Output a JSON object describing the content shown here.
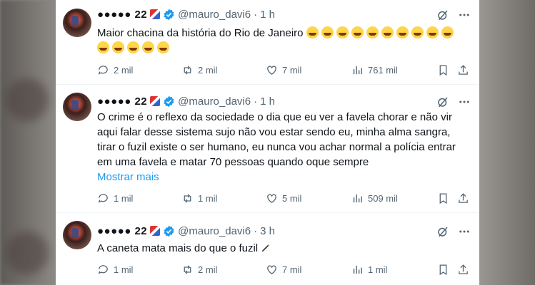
{
  "tweets": [
    {
      "name": "●●●●● 22",
      "handle": "@mauro_davi6",
      "dot": "·",
      "time": "1 h",
      "text": "Maior chacina da história do Rio de Janeiro",
      "emoji_count": 15,
      "more": "",
      "replies": "2 mil",
      "retweets": "2 mil",
      "likes": "7 mil",
      "views": "761 mil"
    },
    {
      "name": "●●●●● 22",
      "handle": "@mauro_davi6",
      "dot": "·",
      "time": "1 h",
      "text": "O crime é o reflexo da sociedade o dia que eu ver a favela chorar e não vir aqui falar desse sistema sujo não vou estar sendo eu, minha alma sangra, tirar o fuzil existe o ser humano, eu nunca vou achar normal a polícia entrar em uma favela e matar 70 pessoas quando oque sempre",
      "more": "Mostrar mais",
      "replies": "1 mil",
      "retweets": "1 mil",
      "likes": "5 mil",
      "views": "509 mil"
    },
    {
      "name": "●●●●● 22",
      "handle": "@mauro_davi6",
      "dot": "·",
      "time": "3 h",
      "text": "A caneta mata mais do que o fuzil",
      "more": "",
      "replies": "1 mil",
      "retweets": "2 mil",
      "likes": "7 mil",
      "views": "1 mil"
    }
  ],
  "icons": [
    "reply-icon",
    "retweet-icon",
    "like-icon",
    "views-icon",
    "bookmark-icon",
    "share-icon",
    "grok-icon",
    "more-icon",
    "verified-icon"
  ],
  "colors": {
    "accent": "#1d9bf0",
    "muted": "#536471",
    "text": "#0f1419"
  }
}
